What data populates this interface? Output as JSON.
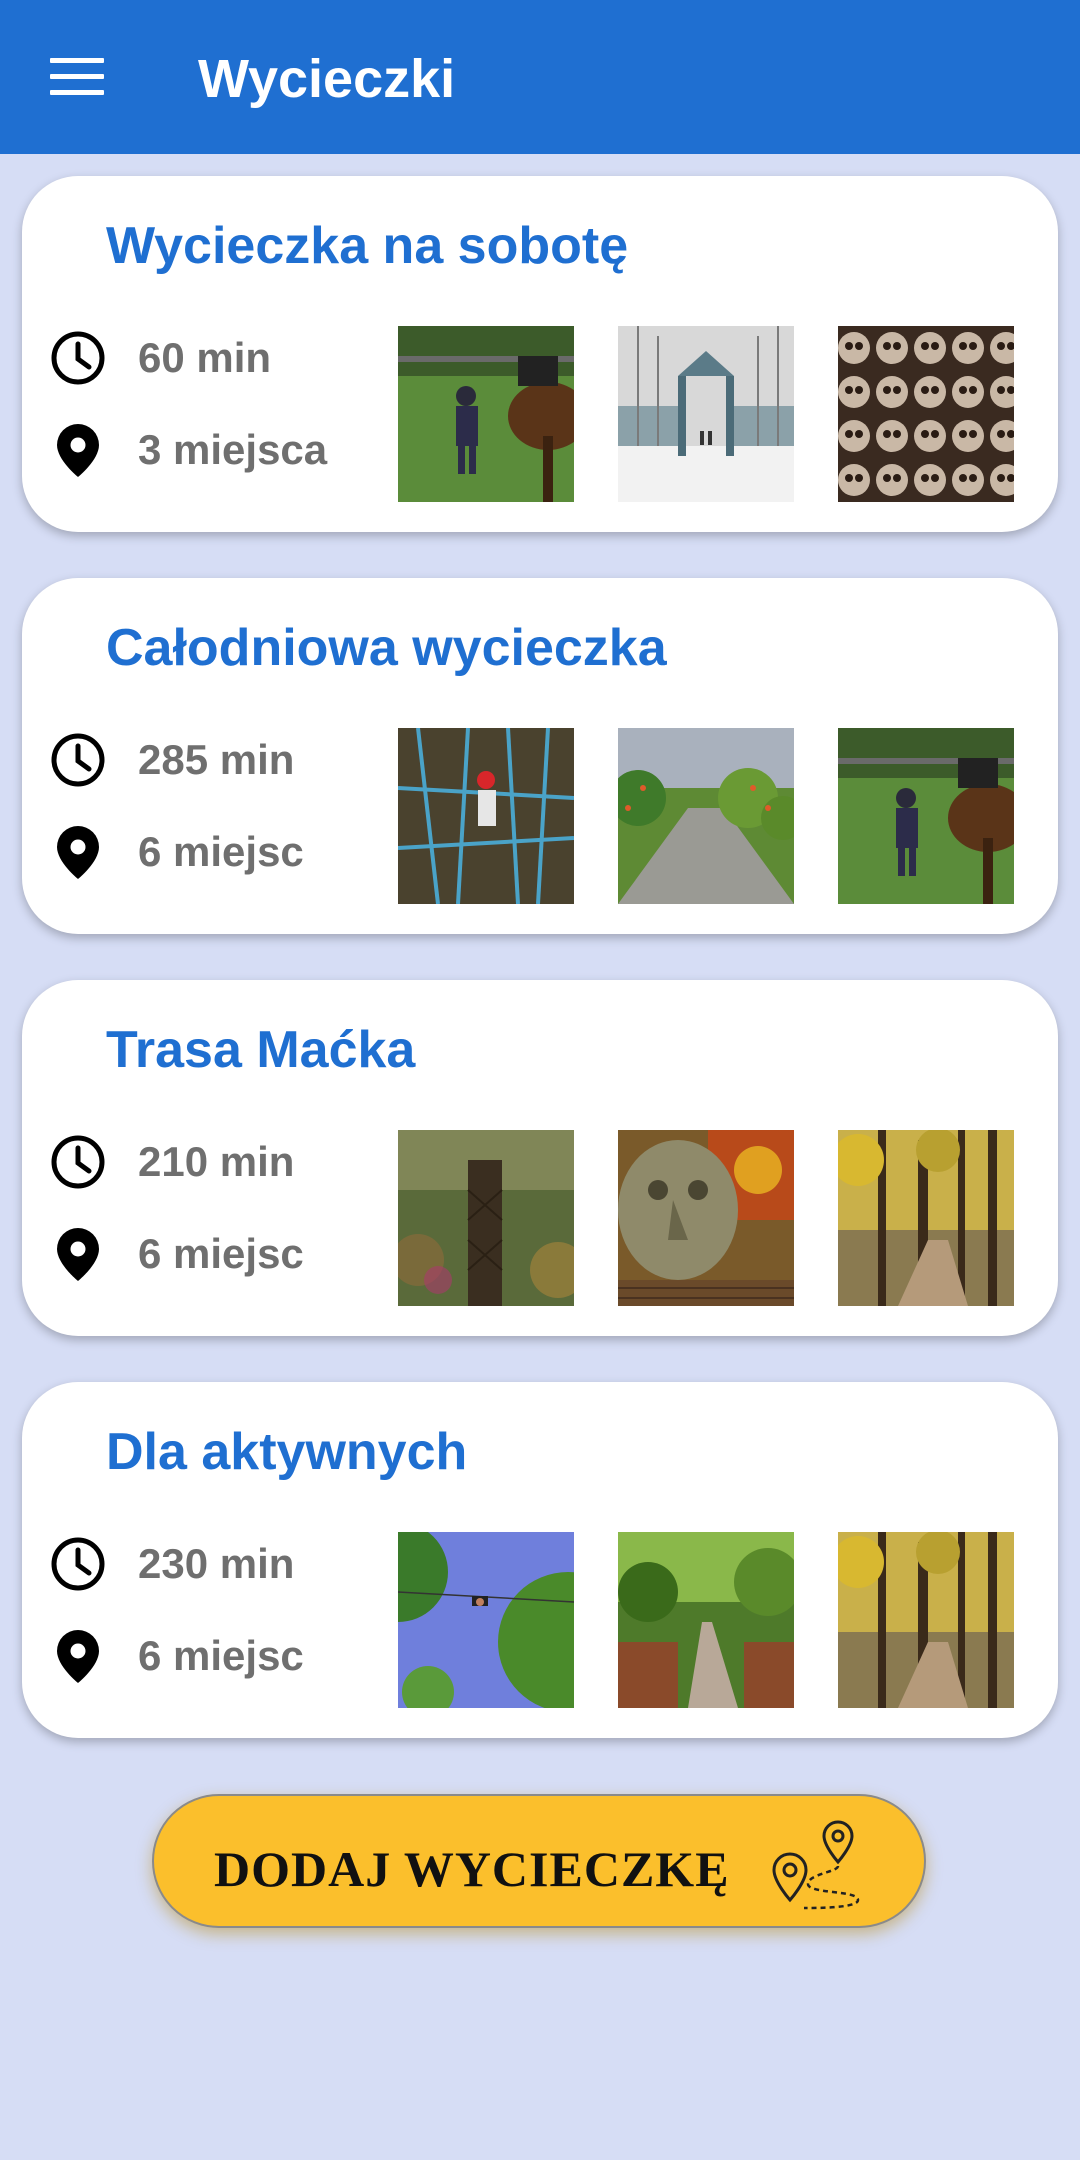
{
  "header": {
    "title": "Wycieczki",
    "menu_icon": "hamburger-menu-icon"
  },
  "colors": {
    "primary": "#1f6fd1",
    "background": "#d6ddf5",
    "accent": "#fbbf2c"
  },
  "trips": [
    {
      "title": "Wycieczka na sobotę",
      "duration": "60 min",
      "places": "3 miejsca",
      "photos": [
        "child-with-horse",
        "snowy-gate-avenue",
        "skull-chapel"
      ]
    },
    {
      "title": "Całodniowa wycieczka",
      "duration": "285 min",
      "places": "6 miejsc",
      "photos": [
        "rope-park",
        "garden-path",
        "child-with-horse"
      ]
    },
    {
      "title": "Trasa Maćka",
      "duration": "210 min",
      "places": "6 miejsc",
      "photos": [
        "forest-tower",
        "stone-face-sculpture",
        "autumn-forest-path"
      ]
    },
    {
      "title": "Dla aktywnych",
      "duration": "230 min",
      "places": "6 miejsc",
      "photos": [
        "zipline-sky",
        "palm-house-alley",
        "autumn-forest-path"
      ]
    }
  ],
  "add_button": {
    "label": "DODAJ WYCIECZKĘ",
    "icon": "route-pins-icon"
  }
}
